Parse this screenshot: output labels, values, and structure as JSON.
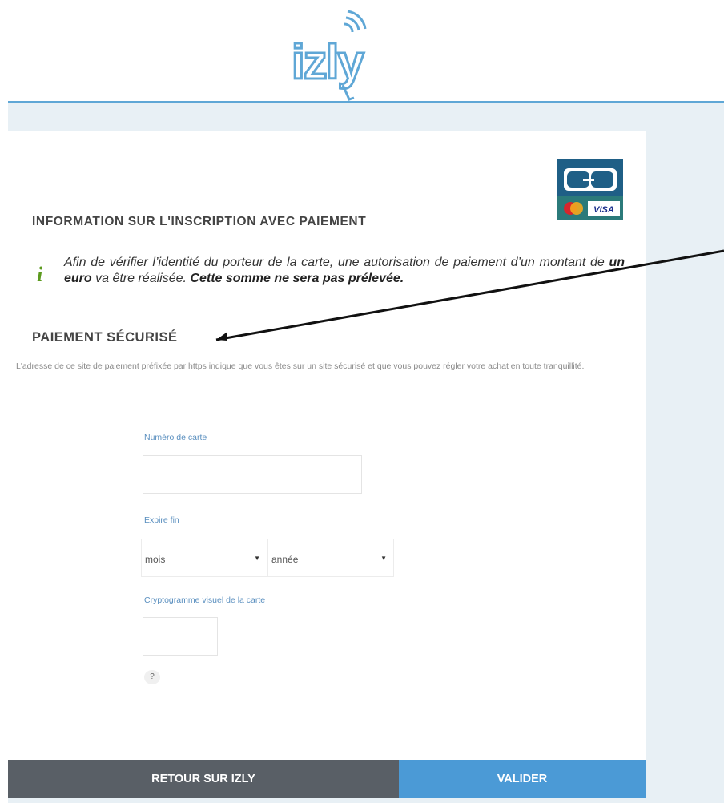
{
  "header": {
    "logo_text": "izly"
  },
  "card_logos": {
    "cb": "CB",
    "visa": "VISA",
    "mastercard": "mastercard"
  },
  "registration": {
    "title": "INFORMATION SUR L'INSCRIPTION AVEC PAIEMENT",
    "info_icon": "i",
    "info_before": "Afin de vérifier l’identité du porteur de la carte, une autorisation de paiement d’un montant de ",
    "info_amount": "un euro",
    "info_middle": " va être réalisée. ",
    "info_bold": "Cette somme ne sera pas prélevée."
  },
  "secure": {
    "title": "PAIEMENT SÉCURISÉ",
    "description": "L'adresse de ce site de paiement préfixée par https indique que vous êtes sur un site sécurisé et que vous pouvez régler votre achat en toute tranquillité."
  },
  "form": {
    "card_number_label": "Numéro de carte",
    "card_number_value": "",
    "expiry_label": "Expire fin",
    "month_selected": "mois",
    "year_selected": "année",
    "cvv_label": "Cryptogramme visuel de la carte",
    "cvv_value": "",
    "help_label": "?"
  },
  "buttons": {
    "back": "RETOUR SUR IZLY",
    "submit": "VALIDER"
  },
  "colors": {
    "accent": "#4b9ad6",
    "dark_button": "#595f66",
    "info_icon": "#5c9a1e",
    "background": "#e8f0f5"
  }
}
